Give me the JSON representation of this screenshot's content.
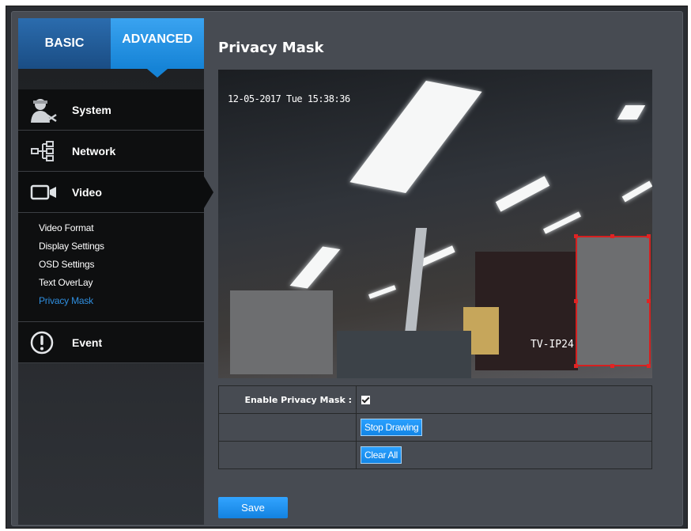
{
  "sidebar": {
    "tabs": {
      "basic": "BASIC",
      "advanced": "ADVANCED"
    },
    "items": [
      {
        "label": "System",
        "icon": "system-user-icon"
      },
      {
        "label": "Network",
        "icon": "network-icon"
      },
      {
        "label": "Video",
        "icon": "video-camera-icon"
      },
      {
        "label": "Event",
        "icon": "exclamation-icon"
      }
    ],
    "video_submenu": [
      "Video Format",
      "Display Settings",
      "OSD Settings",
      "Text OverLay",
      "Privacy Mask"
    ]
  },
  "main": {
    "title": "Privacy Mask",
    "video": {
      "timestamp": "12-05-2017 Tue 15:38:36",
      "camera_label": "TV-IP24"
    },
    "options": {
      "enable_label": "Enable Privacy Mask :",
      "enable_checked": true,
      "stop_drawing": "Stop Drawing",
      "clear_all": "Clear All"
    },
    "save": "Save"
  },
  "colors": {
    "accent": "#1583d6",
    "active_submenu": "#2f8fe0",
    "mask": "#6d6e70",
    "mask_border": "#d42020"
  }
}
